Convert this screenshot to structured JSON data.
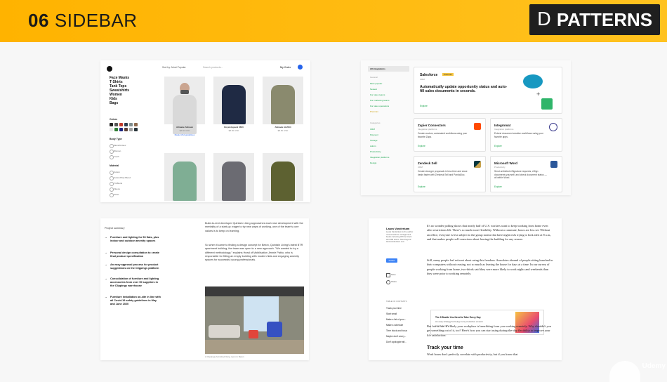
{
  "header": {
    "number": "06",
    "title": "SIDEBAR",
    "badge_letter": "D",
    "badge_text": "PATTERNS"
  },
  "card1": {
    "categories": [
      "Face Masks",
      "T-Shirts",
      "Tank Tops",
      "Sweatshirts",
      "Women",
      "Kids",
      "Bags"
    ],
    "colors_title": "Colors",
    "body_type_title": "Body Type",
    "body_types": [
      "Mens/Unisex",
      "Women",
      "Youth"
    ],
    "material_title": "Material",
    "materials": [
      "Cotton",
      "Cotton/Poly Blend",
      "Tri-Blend",
      "Fleece",
      "Other"
    ],
    "sort_label": "Sort by: Most Popular",
    "search_placeholder": "Search products...",
    "my_order": "My Order",
    "products": [
      {
        "name": "Allmade Allmask",
        "price": "$8.50 USD"
      },
      {
        "name": "Royal Apparel 6600",
        "price": "$8.50 USD"
      },
      {
        "name": "Allmade AL2004",
        "price": "$8.50 USD"
      }
    ],
    "ppe_link": "Made-USA guidelines",
    "swatch_colors": [
      "#222222",
      "#555555",
      "#c0392b",
      "#2c3e50",
      "#7f8c8d",
      "#8e6b4f",
      "#e8e8e8",
      "#2e7d32",
      "#1a237e",
      "#5d4037",
      "#9e9e9e",
      "#263238"
    ]
  },
  "card2": {
    "sidebar_title": "All integrations",
    "sidebar_group1": "General",
    "sidebar_links": [
      "Most popular",
      "Newest",
      "For sales teams",
      "For marketing teams",
      "For sales operations",
      "Premium"
    ],
    "sidebar_group2": "Categories",
    "sidebar_cats": [
      "CRM",
      "Payment",
      "Storage",
      "Admin",
      "Productivity",
      "Integration platforms",
      "Design"
    ],
    "featured": {
      "name": "Salesforce",
      "tag": "Premium",
      "sub": "CRM",
      "headline": "Automatically update opportunity status and auto-fill sales documents in seconds.",
      "explore": "Explore"
    },
    "items": [
      {
        "name": "Zapier Connectors",
        "sub": "Integration platforms",
        "desc": "Create custom, automated workflows using your favorite Zaps.",
        "explore": "Explore"
      },
      {
        "name": "Integromat",
        "sub": "Integration platforms",
        "desc": "Extend document creation workflows using your favorite apps.",
        "explore": "Explore"
      },
      {
        "name": "Zendesk Sell",
        "sub": "CRM",
        "desc": "Create stronger proposals in less time and close deals faster with Zendesk Sell and PandaDoc.",
        "explore": "Explore"
      },
      {
        "name": "Microsoft Word",
        "sub": "Productivity",
        "desc": "Send unlimited eSignature requests, eSign documents yourself, and check document status — all within Word.",
        "explore": "Explore"
      }
    ]
  },
  "card3": {
    "summary_title": "Project summary",
    "bullets": [
      "Furniture and lighting for 53 flats, plus indoor and outdoor amenity spaces",
      "Personal design consultation to create final product specification",
      "An easy approval process for product suggestions on the Clippings platform",
      "Consolidation of furniture and lighting accessories from over 50 suppliers in the Clippings warehouse",
      "Furniture installation on-site in line with all Covid-19 safety guidelines in May and June 2020"
    ],
    "para1": "Build-to-rent developer Quintain Living approaches each new development with the mentality of a start-up: eager to try new ways of working, one of the team's core values is to keep on learning.",
    "para2": "So when it came to finding a design concept for Beton, Quintain Living's latest BTR apartment building, the team was open to a new approach. \"We wanted to try a different methodology,\" explains Head of Mobilisation Jennie Pablo, who is responsible for fitting an empty building with modern flats and engaging amenity spaces for successful young professionals.",
    "caption": "A Clippings-furnished living room in Beton"
  },
  "card4": {
    "author": "Laura Vanderkam",
    "author_bio": "Laura Vanderkam is the author of several time management books including Off the Clock and 168 Hours. She blogs at lauravanderkam.com",
    "follow": "Follow",
    "actions": [
      "Save",
      "Share"
    ],
    "toc_title": "TABLE OF CONTENTS",
    "toc": [
      "Track your time",
      "Start small",
      "Make a list of your...",
      "Make a schedule",
      "Time block and focus",
      "Maybe don't worry...",
      "Don't apologize aft..."
    ],
    "p1": "It's no wonder polling shows that nearly half of U.S. workers want to keep working from home even after restrictions lift. There's so much more flexibility. Without a commute, hours are less set. Without an office, everyone is less subject to the group norms that have night owls trying to look alert at 8 a.m., and that makes people self-conscious about leaving the building for any reason.",
    "p2": "Still, many people feel reticent about using this freedom. Anecdotes abound of people sitting hunched in their computers without ceasing, not so much as leaving the house for days at a time. In our survey of people working from home, two-thirds said they were more likely to work nights and weekends than they were prior to working remotely.",
    "quote_title": "The 9 Braids You Need to Take Every Day",
    "quote_desc": "An easy strategy for being more productive at work",
    "quote_site": "fastcompany.com",
    "p3": "But fair is fair: It's likely your workplace is benefitting from you working remotely. Why shouldn't you get something out of it, too? Here's how you can start using during-the-day flexibility to improve your life satisfaction:",
    "h2": "Track your time",
    "p4": "Work hours don't perfectly correlate with productivity, but if you know that"
  },
  "watermark": "Udemy"
}
